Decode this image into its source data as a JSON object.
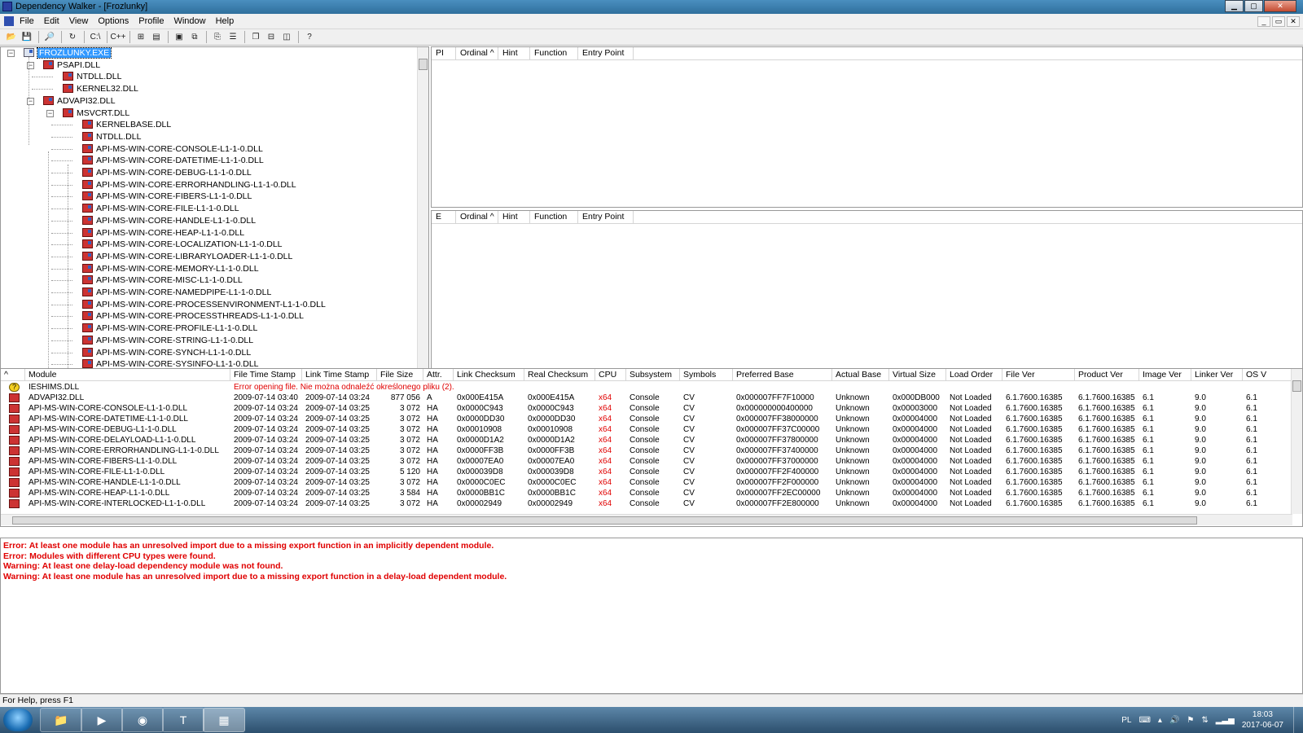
{
  "window": {
    "title": "Dependency Walker - [Frozlunky]"
  },
  "menu": [
    "File",
    "Edit",
    "View",
    "Options",
    "Profile",
    "Window",
    "Help"
  ],
  "tree": {
    "items": [
      {
        "label": "FROZLUNKY.EXE",
        "depth": 0,
        "expander": "−",
        "selected": true,
        "exe": true
      },
      {
        "label": "PSAPI.DLL",
        "depth": 1,
        "expander": "−"
      },
      {
        "label": "NTDLL.DLL",
        "depth": 2
      },
      {
        "label": "KERNEL32.DLL",
        "depth": 2
      },
      {
        "label": "ADVAPI32.DLL",
        "depth": 1,
        "expander": "−"
      },
      {
        "label": "MSVCRT.DLL",
        "depth": 2,
        "expander": "−"
      },
      {
        "label": "KERNELBASE.DLL",
        "depth": 3
      },
      {
        "label": "NTDLL.DLL",
        "depth": 3
      },
      {
        "label": "API-MS-WIN-CORE-CONSOLE-L1-1-0.DLL",
        "depth": 3
      },
      {
        "label": "API-MS-WIN-CORE-DATETIME-L1-1-0.DLL",
        "depth": 3
      },
      {
        "label": "API-MS-WIN-CORE-DEBUG-L1-1-0.DLL",
        "depth": 3
      },
      {
        "label": "API-MS-WIN-CORE-ERRORHANDLING-L1-1-0.DLL",
        "depth": 3
      },
      {
        "label": "API-MS-WIN-CORE-FIBERS-L1-1-0.DLL",
        "depth": 3
      },
      {
        "label": "API-MS-WIN-CORE-FILE-L1-1-0.DLL",
        "depth": 3
      },
      {
        "label": "API-MS-WIN-CORE-HANDLE-L1-1-0.DLL",
        "depth": 3
      },
      {
        "label": "API-MS-WIN-CORE-HEAP-L1-1-0.DLL",
        "depth": 3
      },
      {
        "label": "API-MS-WIN-CORE-LOCALIZATION-L1-1-0.DLL",
        "depth": 3
      },
      {
        "label": "API-MS-WIN-CORE-LIBRARYLOADER-L1-1-0.DLL",
        "depth": 3
      },
      {
        "label": "API-MS-WIN-CORE-MEMORY-L1-1-0.DLL",
        "depth": 3
      },
      {
        "label": "API-MS-WIN-CORE-MISC-L1-1-0.DLL",
        "depth": 3
      },
      {
        "label": "API-MS-WIN-CORE-NAMEDPIPE-L1-1-0.DLL",
        "depth": 3
      },
      {
        "label": "API-MS-WIN-CORE-PROCESSENVIRONMENT-L1-1-0.DLL",
        "depth": 3
      },
      {
        "label": "API-MS-WIN-CORE-PROCESSTHREADS-L1-1-0.DLL",
        "depth": 3
      },
      {
        "label": "API-MS-WIN-CORE-PROFILE-L1-1-0.DLL",
        "depth": 3
      },
      {
        "label": "API-MS-WIN-CORE-STRING-L1-1-0.DLL",
        "depth": 3
      },
      {
        "label": "API-MS-WIN-CORE-SYNCH-L1-1-0.DLL",
        "depth": 3
      },
      {
        "label": "API-MS-WIN-CORE-SYSINFO-L1-1-0.DLL",
        "depth": 3
      }
    ]
  },
  "imports_pane": {
    "columns": [
      "PI",
      "Ordinal ^",
      "Hint",
      "Function",
      "Entry Point"
    ]
  },
  "exports_pane": {
    "columns": [
      "E",
      "Ordinal ^",
      "Hint",
      "Function",
      "Entry Point"
    ]
  },
  "module_list": {
    "columns": [
      "^",
      "Module",
      "File Time Stamp",
      "Link Time Stamp",
      "File Size",
      "Attr.",
      "Link Checksum",
      "Real Checksum",
      "CPU",
      "Subsystem",
      "Symbols",
      "Preferred Base",
      "Actual Base",
      "Virtual Size",
      "Load Order",
      "File Ver",
      "Product Ver",
      "Image Ver",
      "Linker Ver",
      "OS V"
    ],
    "error_row": {
      "module": "IESHIMS.DLL",
      "message": "Error opening file. Nie można odnaleźć określonego pliku (2)."
    },
    "rows": [
      {
        "module": "ADVAPI32.DLL",
        "file_ts": "2009-07-14 03:40",
        "link_ts": "2009-07-14 03:24",
        "size": "877 056",
        "attr": "A",
        "link_cs": "0x000E415A",
        "real_cs": "0x000E415A",
        "cpu": "x64",
        "subsystem": "Console",
        "symbols": "CV",
        "pref_base": "0x000007FF7F10000",
        "actual_base": "Unknown",
        "vsize": "0x000DB000",
        "load_order": "Not Loaded",
        "file_ver": "6.1.7600.16385",
        "product_ver": "6.1.7600.16385",
        "image_ver": "6.1",
        "linker_ver": "9.0",
        "os_ver": "6.1"
      },
      {
        "module": "API-MS-WIN-CORE-CONSOLE-L1-1-0.DLL",
        "file_ts": "2009-07-14 03:24",
        "link_ts": "2009-07-14 03:25",
        "size": "3 072",
        "attr": "HA",
        "link_cs": "0x0000C943",
        "real_cs": "0x0000C943",
        "cpu": "x64",
        "subsystem": "Console",
        "symbols": "CV",
        "pref_base": "0x000000000400000",
        "actual_base": "Unknown",
        "vsize": "0x00003000",
        "load_order": "Not Loaded",
        "file_ver": "6.1.7600.16385",
        "product_ver": "6.1.7600.16385",
        "image_ver": "6.1",
        "linker_ver": "9.0",
        "os_ver": "6.1"
      },
      {
        "module": "API-MS-WIN-CORE-DATETIME-L1-1-0.DLL",
        "file_ts": "2009-07-14 03:24",
        "link_ts": "2009-07-14 03:25",
        "size": "3 072",
        "attr": "HA",
        "link_cs": "0x0000DD30",
        "real_cs": "0x0000DD30",
        "cpu": "x64",
        "subsystem": "Console",
        "symbols": "CV",
        "pref_base": "0x000007FF38000000",
        "actual_base": "Unknown",
        "vsize": "0x00004000",
        "load_order": "Not Loaded",
        "file_ver": "6.1.7600.16385",
        "product_ver": "6.1.7600.16385",
        "image_ver": "6.1",
        "linker_ver": "9.0",
        "os_ver": "6.1"
      },
      {
        "module": "API-MS-WIN-CORE-DEBUG-L1-1-0.DLL",
        "file_ts": "2009-07-14 03:24",
        "link_ts": "2009-07-14 03:25",
        "size": "3 072",
        "attr": "HA",
        "link_cs": "0x00010908",
        "real_cs": "0x00010908",
        "cpu": "x64",
        "subsystem": "Console",
        "symbols": "CV",
        "pref_base": "0x000007FF37C00000",
        "actual_base": "Unknown",
        "vsize": "0x00004000",
        "load_order": "Not Loaded",
        "file_ver": "6.1.7600.16385",
        "product_ver": "6.1.7600.16385",
        "image_ver": "6.1",
        "linker_ver": "9.0",
        "os_ver": "6.1"
      },
      {
        "module": "API-MS-WIN-CORE-DELAYLOAD-L1-1-0.DLL",
        "file_ts": "2009-07-14 03:24",
        "link_ts": "2009-07-14 03:25",
        "size": "3 072",
        "attr": "HA",
        "link_cs": "0x0000D1A2",
        "real_cs": "0x0000D1A2",
        "cpu": "x64",
        "subsystem": "Console",
        "symbols": "CV",
        "pref_base": "0x000007FF37800000",
        "actual_base": "Unknown",
        "vsize": "0x00004000",
        "load_order": "Not Loaded",
        "file_ver": "6.1.7600.16385",
        "product_ver": "6.1.7600.16385",
        "image_ver": "6.1",
        "linker_ver": "9.0",
        "os_ver": "6.1"
      },
      {
        "module": "API-MS-WIN-CORE-ERRORHANDLING-L1-1-0.DLL",
        "file_ts": "2009-07-14 03:24",
        "link_ts": "2009-07-14 03:25",
        "size": "3 072",
        "attr": "HA",
        "link_cs": "0x0000FF3B",
        "real_cs": "0x0000FF3B",
        "cpu": "x64",
        "subsystem": "Console",
        "symbols": "CV",
        "pref_base": "0x000007FF37400000",
        "actual_base": "Unknown",
        "vsize": "0x00004000",
        "load_order": "Not Loaded",
        "file_ver": "6.1.7600.16385",
        "product_ver": "6.1.7600.16385",
        "image_ver": "6.1",
        "linker_ver": "9.0",
        "os_ver": "6.1"
      },
      {
        "module": "API-MS-WIN-CORE-FIBERS-L1-1-0.DLL",
        "file_ts": "2009-07-14 03:24",
        "link_ts": "2009-07-14 03:25",
        "size": "3 072",
        "attr": "HA",
        "link_cs": "0x00007EA0",
        "real_cs": "0x00007EA0",
        "cpu": "x64",
        "subsystem": "Console",
        "symbols": "CV",
        "pref_base": "0x000007FF37000000",
        "actual_base": "Unknown",
        "vsize": "0x00004000",
        "load_order": "Not Loaded",
        "file_ver": "6.1.7600.16385",
        "product_ver": "6.1.7600.16385",
        "image_ver": "6.1",
        "linker_ver": "9.0",
        "os_ver": "6.1"
      },
      {
        "module": "API-MS-WIN-CORE-FILE-L1-1-0.DLL",
        "file_ts": "2009-07-14 03:24",
        "link_ts": "2009-07-14 03:25",
        "size": "5 120",
        "attr": "HA",
        "link_cs": "0x000039D8",
        "real_cs": "0x000039D8",
        "cpu": "x64",
        "subsystem": "Console",
        "symbols": "CV",
        "pref_base": "0x000007FF2F400000",
        "actual_base": "Unknown",
        "vsize": "0x00004000",
        "load_order": "Not Loaded",
        "file_ver": "6.1.7600.16385",
        "product_ver": "6.1.7600.16385",
        "image_ver": "6.1",
        "linker_ver": "9.0",
        "os_ver": "6.1"
      },
      {
        "module": "API-MS-WIN-CORE-HANDLE-L1-1-0.DLL",
        "file_ts": "2009-07-14 03:24",
        "link_ts": "2009-07-14 03:25",
        "size": "3 072",
        "attr": "HA",
        "link_cs": "0x0000C0EC",
        "real_cs": "0x0000C0EC",
        "cpu": "x64",
        "subsystem": "Console",
        "symbols": "CV",
        "pref_base": "0x000007FF2F000000",
        "actual_base": "Unknown",
        "vsize": "0x00004000",
        "load_order": "Not Loaded",
        "file_ver": "6.1.7600.16385",
        "product_ver": "6.1.7600.16385",
        "image_ver": "6.1",
        "linker_ver": "9.0",
        "os_ver": "6.1"
      },
      {
        "module": "API-MS-WIN-CORE-HEAP-L1-1-0.DLL",
        "file_ts": "2009-07-14 03:24",
        "link_ts": "2009-07-14 03:25",
        "size": "3 584",
        "attr": "HA",
        "link_cs": "0x0000BB1C",
        "real_cs": "0x0000BB1C",
        "cpu": "x64",
        "subsystem": "Console",
        "symbols": "CV",
        "pref_base": "0x000007FF2EC00000",
        "actual_base": "Unknown",
        "vsize": "0x00004000",
        "load_order": "Not Loaded",
        "file_ver": "6.1.7600.16385",
        "product_ver": "6.1.7600.16385",
        "image_ver": "6.1",
        "linker_ver": "9.0",
        "os_ver": "6.1"
      },
      {
        "module": "API-MS-WIN-CORE-INTERLOCKED-L1-1-0.DLL",
        "file_ts": "2009-07-14 03:24",
        "link_ts": "2009-07-14 03:25",
        "size": "3 072",
        "attr": "HA",
        "link_cs": "0x00002949",
        "real_cs": "0x00002949",
        "cpu": "x64",
        "subsystem": "Console",
        "symbols": "CV",
        "pref_base": "0x000007FF2E800000",
        "actual_base": "Unknown",
        "vsize": "0x00004000",
        "load_order": "Not Loaded",
        "file_ver": "6.1.7600.16385",
        "product_ver": "6.1.7600.16385",
        "image_ver": "6.1",
        "linker_ver": "9.0",
        "os_ver": "6.1"
      }
    ]
  },
  "log": [
    "Error: At least one module has an unresolved import due to a missing export function in an implicitly dependent module.",
    "Error: Modules with different CPU types were found.",
    "Warning: At least one delay-load dependency module was not found.",
    "Warning: At least one module has an unresolved import due to a missing export function in a delay-load dependent module."
  ],
  "status_bar": {
    "text": "For Help, press F1"
  },
  "taskbar": {
    "language": "PL",
    "time": "18:03",
    "date": "2017-06-07"
  },
  "colors": {
    "error_text": "#e00000",
    "selection": "#3399ff"
  }
}
